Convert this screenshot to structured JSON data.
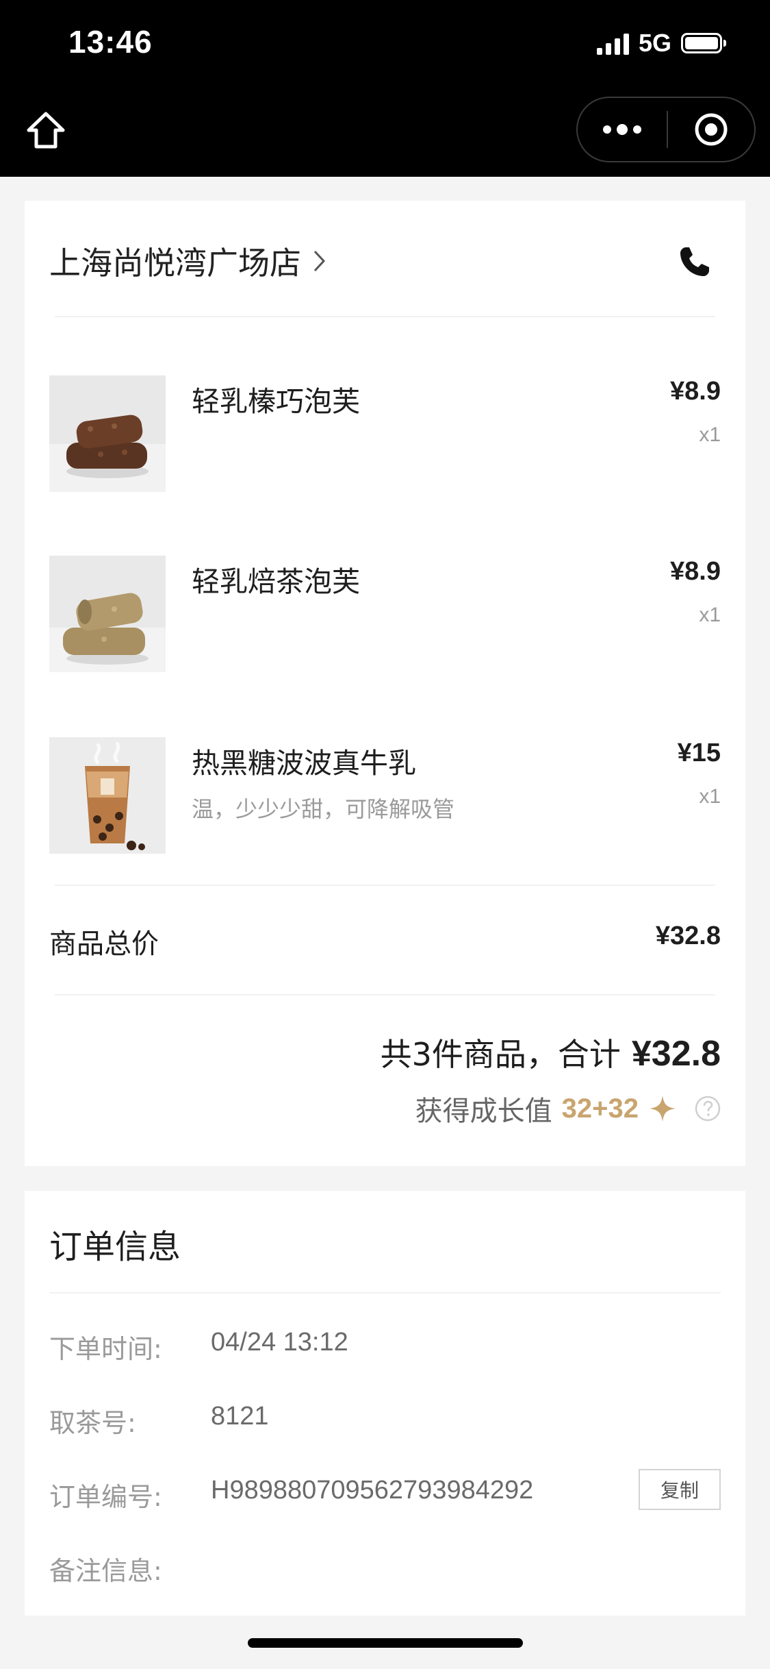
{
  "status_bar": {
    "time": "13:46",
    "network": "5G",
    "battery_level": 1.0
  },
  "nav": {
    "home_icon": "home-icon",
    "more_icon": "more-dots-icon",
    "close_icon": "target-close-icon"
  },
  "store": {
    "name": "上海尚悦湾广场店",
    "phone_icon": "phone-icon"
  },
  "items": [
    {
      "name": "轻乳榛巧泡芙",
      "spec": "",
      "price": "¥8.9",
      "qty": "x1"
    },
    {
      "name": "轻乳焙茶泡芙",
      "spec": "",
      "price": "¥8.9",
      "qty": "x1"
    },
    {
      "name": "热黑糖波波真牛乳",
      "spec": "温，少少少甜，可降解吸管",
      "price": "¥15",
      "qty": "x1"
    }
  ],
  "summary": {
    "subtotal_label": "商品总价",
    "subtotal_value": "¥32.8",
    "count_text": "共3件商品，合计",
    "total_amount": "¥32.8",
    "growth_label": "获得成长值",
    "growth_value": "32+32"
  },
  "order_info": {
    "title": "订单信息",
    "rows": [
      {
        "label": "下单时间:",
        "value": "04/24 13:12"
      },
      {
        "label": "取茶号:",
        "value": "8121"
      },
      {
        "label": "订单编号:",
        "value": "H989880709562793984292"
      },
      {
        "label": "备注信息:",
        "value": ""
      }
    ],
    "copy_label": "复制"
  },
  "colors": {
    "accent_gold": "#c8a56f",
    "topbar": "#000000",
    "page_bg": "#f4f4f4"
  }
}
